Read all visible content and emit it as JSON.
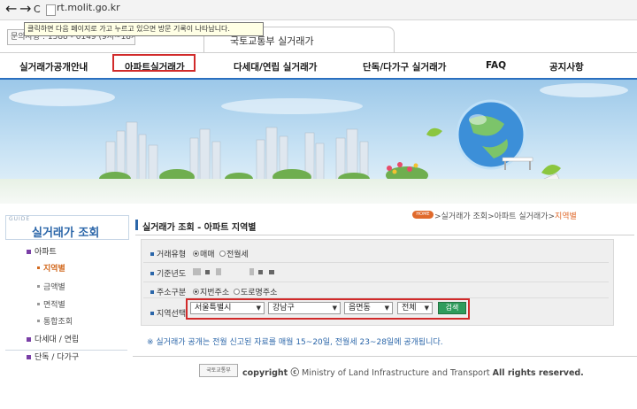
{
  "browser": {
    "url": "rt.molit.go.kr",
    "back": "←",
    "forward": "→",
    "reload": "C"
  },
  "header": {
    "site_title": "국토교통부 실거래가",
    "contact": "문의사항 : 1588 - 0149 (9시~18시)",
    "tooltip": "클릭하면 다음 페이지로 가고 누르고 있으면 방문 기록이 나타납니다."
  },
  "nav": {
    "items": [
      {
        "label": "실거래가공개안내"
      },
      {
        "label": "아파트실거래가"
      },
      {
        "label": "다세대/연립 실거래가"
      },
      {
        "label": "단독/다가구 실거래가"
      },
      {
        "label": "FAQ"
      },
      {
        "label": "공지사항"
      }
    ]
  },
  "sidebar": {
    "guide_small": "GUIDE",
    "title": "실거래가 조회",
    "items": [
      {
        "label": "아파트"
      },
      {
        "label": "지역별"
      },
      {
        "label": "금액별"
      },
      {
        "label": "면적별"
      },
      {
        "label": "통합조회"
      },
      {
        "label": "다세대 / 연립"
      },
      {
        "label": "단독 / 다가구"
      }
    ]
  },
  "content": {
    "title": "실거래가 조회 - 아파트 지역별",
    "home_badge": "HOME",
    "breadcrumb_prefix": ">실거래가 조회>아파트 실거래가>",
    "breadcrumb_current": "지역별"
  },
  "form": {
    "trade_type_label": "거래유형",
    "trade_opts": [
      "매매",
      "전월세"
    ],
    "base_year_label": "기준년도",
    "address_label": "주소구분",
    "address_opts": [
      "지번주소",
      "도로명주소"
    ],
    "region_label": "지역선택",
    "sido": "서울특별시",
    "sigungu": "강남구",
    "dong": "읍면동",
    "filter": "전체",
    "search_button": "검색",
    "arrow": "▼"
  },
  "notice": "※ 실거래가 공개는 전월 신고된 자료를 매월 15~20일, 전월세 23~28일에 공개됩니다.",
  "footer": {
    "logo": "국토교통부",
    "copyright_prefix": "copyright ⓒ",
    "copyright_body": "Ministry of Land Infrastructure and Transport",
    "copyright_suffix": "All rights reserved."
  },
  "colors": {
    "accent_blue": "#2b66a9",
    "highlight_red": "#d12a2a",
    "search_green": "#2f9c5c",
    "breadcrumb_orange": "#e06a2c"
  }
}
